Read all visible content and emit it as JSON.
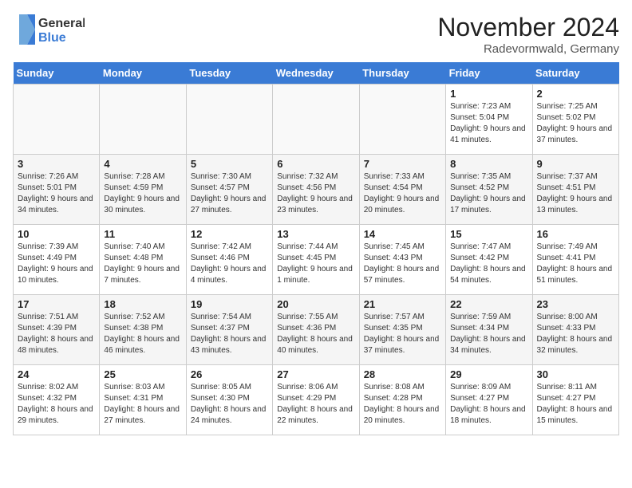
{
  "logo": {
    "text_general": "General",
    "text_blue": "Blue"
  },
  "title": "November 2024",
  "location": "Radevormwald, Germany",
  "days_of_week": [
    "Sunday",
    "Monday",
    "Tuesday",
    "Wednesday",
    "Thursday",
    "Friday",
    "Saturday"
  ],
  "weeks": [
    [
      {
        "day": "",
        "info": ""
      },
      {
        "day": "",
        "info": ""
      },
      {
        "day": "",
        "info": ""
      },
      {
        "day": "",
        "info": ""
      },
      {
        "day": "",
        "info": ""
      },
      {
        "day": "1",
        "info": "Sunrise: 7:23 AM\nSunset: 5:04 PM\nDaylight: 9 hours and 41 minutes."
      },
      {
        "day": "2",
        "info": "Sunrise: 7:25 AM\nSunset: 5:02 PM\nDaylight: 9 hours and 37 minutes."
      }
    ],
    [
      {
        "day": "3",
        "info": "Sunrise: 7:26 AM\nSunset: 5:01 PM\nDaylight: 9 hours and 34 minutes."
      },
      {
        "day": "4",
        "info": "Sunrise: 7:28 AM\nSunset: 4:59 PM\nDaylight: 9 hours and 30 minutes."
      },
      {
        "day": "5",
        "info": "Sunrise: 7:30 AM\nSunset: 4:57 PM\nDaylight: 9 hours and 27 minutes."
      },
      {
        "day": "6",
        "info": "Sunrise: 7:32 AM\nSunset: 4:56 PM\nDaylight: 9 hours and 23 minutes."
      },
      {
        "day": "7",
        "info": "Sunrise: 7:33 AM\nSunset: 4:54 PM\nDaylight: 9 hours and 20 minutes."
      },
      {
        "day": "8",
        "info": "Sunrise: 7:35 AM\nSunset: 4:52 PM\nDaylight: 9 hours and 17 minutes."
      },
      {
        "day": "9",
        "info": "Sunrise: 7:37 AM\nSunset: 4:51 PM\nDaylight: 9 hours and 13 minutes."
      }
    ],
    [
      {
        "day": "10",
        "info": "Sunrise: 7:39 AM\nSunset: 4:49 PM\nDaylight: 9 hours and 10 minutes."
      },
      {
        "day": "11",
        "info": "Sunrise: 7:40 AM\nSunset: 4:48 PM\nDaylight: 9 hours and 7 minutes."
      },
      {
        "day": "12",
        "info": "Sunrise: 7:42 AM\nSunset: 4:46 PM\nDaylight: 9 hours and 4 minutes."
      },
      {
        "day": "13",
        "info": "Sunrise: 7:44 AM\nSunset: 4:45 PM\nDaylight: 9 hours and 1 minute."
      },
      {
        "day": "14",
        "info": "Sunrise: 7:45 AM\nSunset: 4:43 PM\nDaylight: 8 hours and 57 minutes."
      },
      {
        "day": "15",
        "info": "Sunrise: 7:47 AM\nSunset: 4:42 PM\nDaylight: 8 hours and 54 minutes."
      },
      {
        "day": "16",
        "info": "Sunrise: 7:49 AM\nSunset: 4:41 PM\nDaylight: 8 hours and 51 minutes."
      }
    ],
    [
      {
        "day": "17",
        "info": "Sunrise: 7:51 AM\nSunset: 4:39 PM\nDaylight: 8 hours and 48 minutes."
      },
      {
        "day": "18",
        "info": "Sunrise: 7:52 AM\nSunset: 4:38 PM\nDaylight: 8 hours and 46 minutes."
      },
      {
        "day": "19",
        "info": "Sunrise: 7:54 AM\nSunset: 4:37 PM\nDaylight: 8 hours and 43 minutes."
      },
      {
        "day": "20",
        "info": "Sunrise: 7:55 AM\nSunset: 4:36 PM\nDaylight: 8 hours and 40 minutes."
      },
      {
        "day": "21",
        "info": "Sunrise: 7:57 AM\nSunset: 4:35 PM\nDaylight: 8 hours and 37 minutes."
      },
      {
        "day": "22",
        "info": "Sunrise: 7:59 AM\nSunset: 4:34 PM\nDaylight: 8 hours and 34 minutes."
      },
      {
        "day": "23",
        "info": "Sunrise: 8:00 AM\nSunset: 4:33 PM\nDaylight: 8 hours and 32 minutes."
      }
    ],
    [
      {
        "day": "24",
        "info": "Sunrise: 8:02 AM\nSunset: 4:32 PM\nDaylight: 8 hours and 29 minutes."
      },
      {
        "day": "25",
        "info": "Sunrise: 8:03 AM\nSunset: 4:31 PM\nDaylight: 8 hours and 27 minutes."
      },
      {
        "day": "26",
        "info": "Sunrise: 8:05 AM\nSunset: 4:30 PM\nDaylight: 8 hours and 24 minutes."
      },
      {
        "day": "27",
        "info": "Sunrise: 8:06 AM\nSunset: 4:29 PM\nDaylight: 8 hours and 22 minutes."
      },
      {
        "day": "28",
        "info": "Sunrise: 8:08 AM\nSunset: 4:28 PM\nDaylight: 8 hours and 20 minutes."
      },
      {
        "day": "29",
        "info": "Sunrise: 8:09 AM\nSunset: 4:27 PM\nDaylight: 8 hours and 18 minutes."
      },
      {
        "day": "30",
        "info": "Sunrise: 8:11 AM\nSunset: 4:27 PM\nDaylight: 8 hours and 15 minutes."
      }
    ]
  ]
}
